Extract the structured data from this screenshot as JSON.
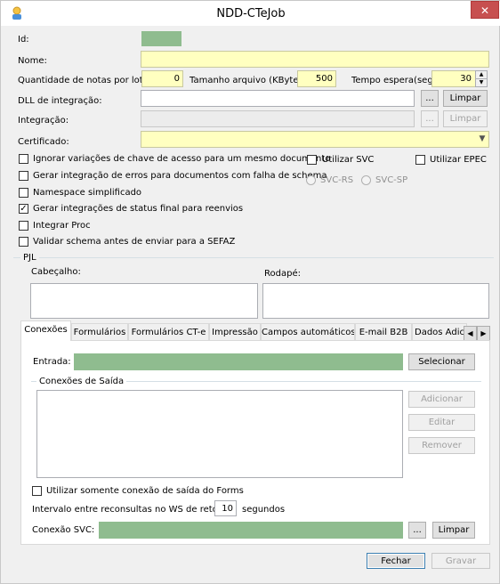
{
  "window": {
    "title": "NDD-CTeJob",
    "close_glyph": "✕"
  },
  "form": {
    "id_label": "Id:",
    "nome_label": "Nome:",
    "qtd_label": "Quantidade de notas por lote:",
    "qtd_value": "0",
    "tamanho_label": "Tamanho arquivo (KBytes):",
    "tamanho_value": "500",
    "tempo_label": "Tempo espera(seg):",
    "tempo_value": "30",
    "dll_label": "DLL de integração:",
    "integracao_label": "Integração:",
    "certificado_label": "Certificado:",
    "browse_label": "...",
    "limpar_label": "Limpar"
  },
  "options": {
    "ignorar": "Ignorar variações de chave de acesso para um mesmo documento",
    "gerar_erros": "Gerar integração de erros para documentos com falha de schema",
    "namespace": "Namespace simplificado",
    "gerar_status": "Gerar integrações de status final para reenvios",
    "integrar_proc": "Integrar Proc",
    "validar_schema": "Validar schema antes de enviar para a SEFAZ",
    "utilizar_svc": "Utilizar SVC",
    "utilizar_epec": "Utilizar EPEC",
    "svc_rs": "SVC-RS",
    "svc_sp": "SVC-SP",
    "check_mark": "✓"
  },
  "pjl": {
    "title": "PJL",
    "cabecalho": "Cabeçalho:",
    "rodape": "Rodapé:"
  },
  "tabs": [
    {
      "label": "Conexões"
    },
    {
      "label": "Formulários"
    },
    {
      "label": "Formulários CT-e"
    },
    {
      "label": "Impressão"
    },
    {
      "label": "Campos automáticos"
    },
    {
      "label": "E-mail B2B"
    },
    {
      "label": "Dados Adic"
    }
  ],
  "tab_scroll": {
    "left": "◀",
    "right": "▶"
  },
  "conexoes": {
    "entrada_label": "Entrada:",
    "selecionar_label": "Selecionar",
    "saida_title": "Conexões de Saída",
    "adicionar": "Adicionar",
    "editar": "Editar",
    "remover": "Remover",
    "somente_forms": "Utilizar somente conexão de saída do Forms",
    "intervalo_label": "Intervalo entre reconsultas no WS de retorno:",
    "intervalo_value": "10",
    "segundos": "segundos",
    "svc_label": "Conexão SVC:",
    "limpar_label": "Limpar"
  },
  "footer": {
    "fechar": "Fechar",
    "gravar": "Gravar"
  },
  "colors": {
    "accent_green": "#8fbc8f",
    "yellow_field": "#ffffc0",
    "close_red": "#c75050"
  }
}
